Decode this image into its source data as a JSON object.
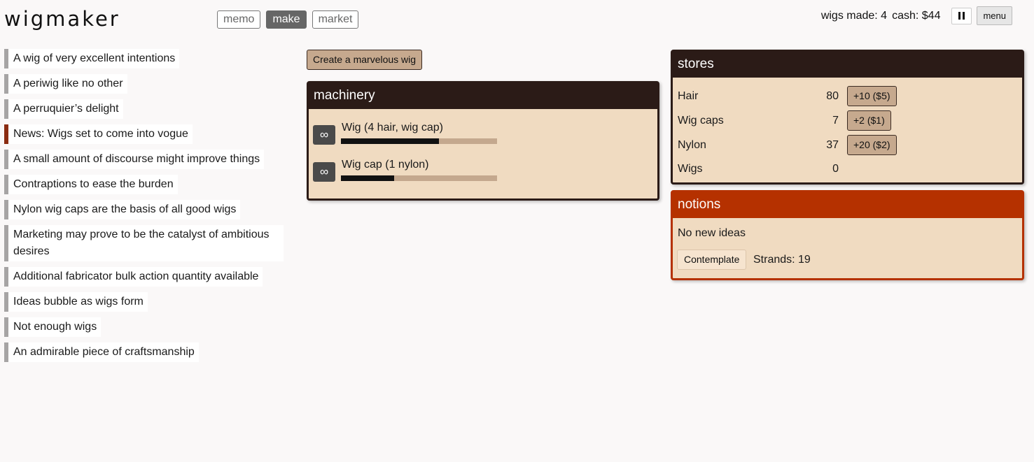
{
  "app": {
    "title": "wigmaker"
  },
  "tabs": [
    {
      "label": "memo",
      "active": false
    },
    {
      "label": "make",
      "active": true
    },
    {
      "label": "market",
      "active": false
    }
  ],
  "status": {
    "wigs_made": "wigs made: 4",
    "cash": "cash: $44",
    "menu_label": "menu"
  },
  "memos": [
    "A wig of very excellent intentions",
    "A periwig like no other",
    "A perruquier’s delight",
    "News: Wigs set to come into vogue",
    "A small amount of discourse might improve things",
    "Contraptions to ease the burden",
    "Nylon wig caps are the basis of all good wigs",
    "Marketing may prove to be the catalyst of ambitious desires",
    "Additional fabricator bulk action quantity available",
    "Ideas bubble as wigs form",
    "Not enough wigs",
    "An admirable piece of craftsmanship"
  ],
  "make": {
    "create_label": "Create a marvelous wig",
    "machinery": {
      "title": "machinery",
      "items": [
        {
          "label": "Wig (4 hair, wig cap)",
          "icon": "infinity-icon",
          "progress": 0.63
        },
        {
          "label": "Wig cap (1 nylon)",
          "icon": "infinity-icon",
          "progress": 0.34
        }
      ]
    }
  },
  "stores": {
    "title": "stores",
    "rows": [
      {
        "name": "Hair",
        "value": "80",
        "buy": "+10 ($5)"
      },
      {
        "name": "Wig caps",
        "value": "7",
        "buy": "+2 ($1)"
      },
      {
        "name": "Nylon",
        "value": "37",
        "buy": "+20 ($2)"
      },
      {
        "name": "Wigs",
        "value": "0",
        "buy": ""
      }
    ]
  },
  "notions": {
    "title": "notions",
    "text": "No new ideas",
    "contemplate_label": "Contemplate",
    "strands": "Strands: 19"
  },
  "colors": {
    "panel_bg": "#f0dbc1",
    "panel_head": "#2b1b17",
    "notions_head": "#b53100",
    "news_bar": "#8a2b10"
  }
}
